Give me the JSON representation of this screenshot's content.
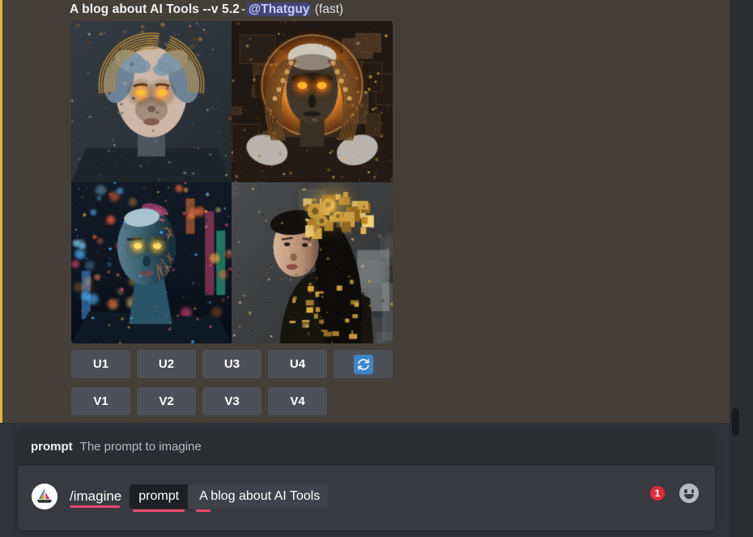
{
  "message": {
    "title": "A blog about AI Tools --v 5.2",
    "separator": "-",
    "mention": "@Thatguy",
    "mode": "(fast)",
    "accent_color": "#e3b341",
    "background_color": "#443f38",
    "mention_bg": "#414675",
    "mention_color": "#c9cdfb"
  },
  "image_grid": {
    "alt_labels": [
      "robotic woman face with glowing orange eyes",
      "symmetric bronze android with glowing halo",
      "cyberpunk android with city bokeh lights",
      "gold and black cyborg woman with mechanical headpiece"
    ]
  },
  "upscale_buttons": [
    {
      "label": "U1"
    },
    {
      "label": "U2"
    },
    {
      "label": "U3"
    },
    {
      "label": "U4"
    }
  ],
  "reroll_button": {
    "icon": "refresh-icon",
    "color": "#3d87c9"
  },
  "variation_buttons": [
    {
      "label": "V1"
    },
    {
      "label": "V2"
    },
    {
      "label": "V3"
    },
    {
      "label": "V4"
    }
  ],
  "composer": {
    "hint_name": "prompt",
    "hint_description": "The prompt to imagine",
    "avatar_icon": "midjourney-sailboat-logo",
    "command": "/imagine",
    "argument_name": "prompt",
    "argument_value": "A blog about AI Tools",
    "underline_color": "#ed4870",
    "notification_count": "1",
    "emoji_icon": "smiley-face-icon"
  },
  "button_style": {
    "background": "#4e5058",
    "text_color": "#ffffff"
  }
}
